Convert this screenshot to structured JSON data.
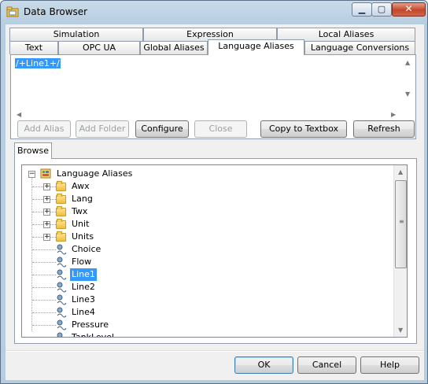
{
  "window": {
    "title": "Data Browser"
  },
  "tabs_back": [
    "Simulation",
    "Expression",
    "Local Aliases"
  ],
  "tabs_front": [
    "Text",
    "OPC UA",
    "Global Aliases",
    "Language Aliases",
    "Language Conversions"
  ],
  "active_tab": "Language Aliases",
  "editor": {
    "value": "/+Line1+/"
  },
  "buttons": {
    "add_alias": "Add Alias",
    "add_folder": "Add Folder",
    "configure": "Configure",
    "close": "Close",
    "copy_to_textbox": "Copy to Textbox",
    "refresh": "Refresh"
  },
  "browse": {
    "tab": "Browse",
    "root": "Language Aliases",
    "folders": [
      "Awx",
      "Lang",
      "Twx",
      "Unit",
      "Units"
    ],
    "aliases": [
      "Choice",
      "Flow",
      "Line1",
      "Line2",
      "Line3",
      "Line4",
      "Pressure",
      "TankLevel"
    ],
    "selected": "Line1"
  },
  "footer": {
    "ok": "OK",
    "cancel": "Cancel",
    "help": "Help"
  },
  "colors": {
    "selection": "#3399ff",
    "folder": "#f2bd3c",
    "window_frame": "#b6cde0"
  }
}
